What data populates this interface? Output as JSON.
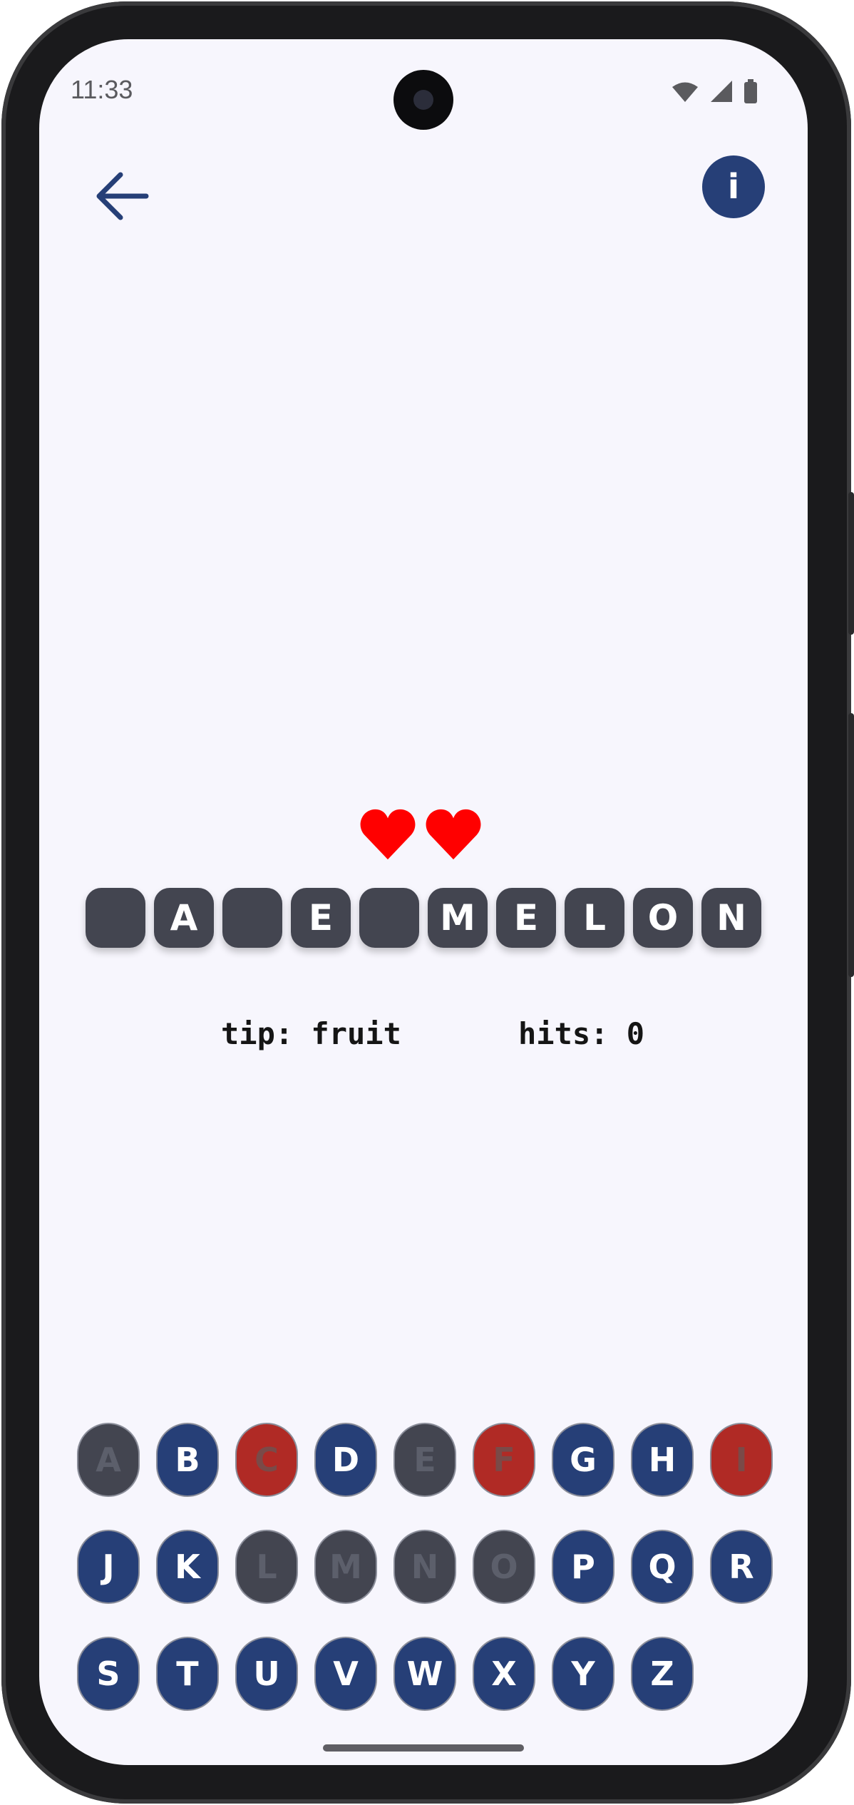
{
  "status_bar": {
    "time": "11:33"
  },
  "header": {
    "back_icon": "arrow-left-icon",
    "info_label": "i"
  },
  "lives": {
    "count": 2,
    "color": "#ff0000"
  },
  "word": {
    "letters": [
      "",
      "A",
      "",
      "E",
      "",
      "M",
      "E",
      "L",
      "O",
      "N"
    ]
  },
  "tip": "tip: fruit",
  "hits": "hits: 0",
  "keyboard": {
    "keys": [
      {
        "label": "A",
        "state": "used"
      },
      {
        "label": "B",
        "state": "available"
      },
      {
        "label": "C",
        "state": "wrong"
      },
      {
        "label": "D",
        "state": "available"
      },
      {
        "label": "E",
        "state": "used"
      },
      {
        "label": "F",
        "state": "wrong"
      },
      {
        "label": "G",
        "state": "available"
      },
      {
        "label": "H",
        "state": "available"
      },
      {
        "label": "I",
        "state": "wrong"
      },
      {
        "label": "J",
        "state": "available"
      },
      {
        "label": "K",
        "state": "available"
      },
      {
        "label": "L",
        "state": "used"
      },
      {
        "label": "M",
        "state": "used"
      },
      {
        "label": "N",
        "state": "used"
      },
      {
        "label": "O",
        "state": "used"
      },
      {
        "label": "P",
        "state": "available"
      },
      {
        "label": "Q",
        "state": "available"
      },
      {
        "label": "R",
        "state": "available"
      },
      {
        "label": "S",
        "state": "available"
      },
      {
        "label": "T",
        "state": "available"
      },
      {
        "label": "U",
        "state": "available"
      },
      {
        "label": "V",
        "state": "available"
      },
      {
        "label": "W",
        "state": "available"
      },
      {
        "label": "X",
        "state": "available"
      },
      {
        "label": "Y",
        "state": "available"
      },
      {
        "label": "Z",
        "state": "available"
      }
    ]
  },
  "colors": {
    "primary": "#263f77",
    "tile": "#434550",
    "wrong": "#b02a25",
    "background": "#f7f6fd"
  }
}
